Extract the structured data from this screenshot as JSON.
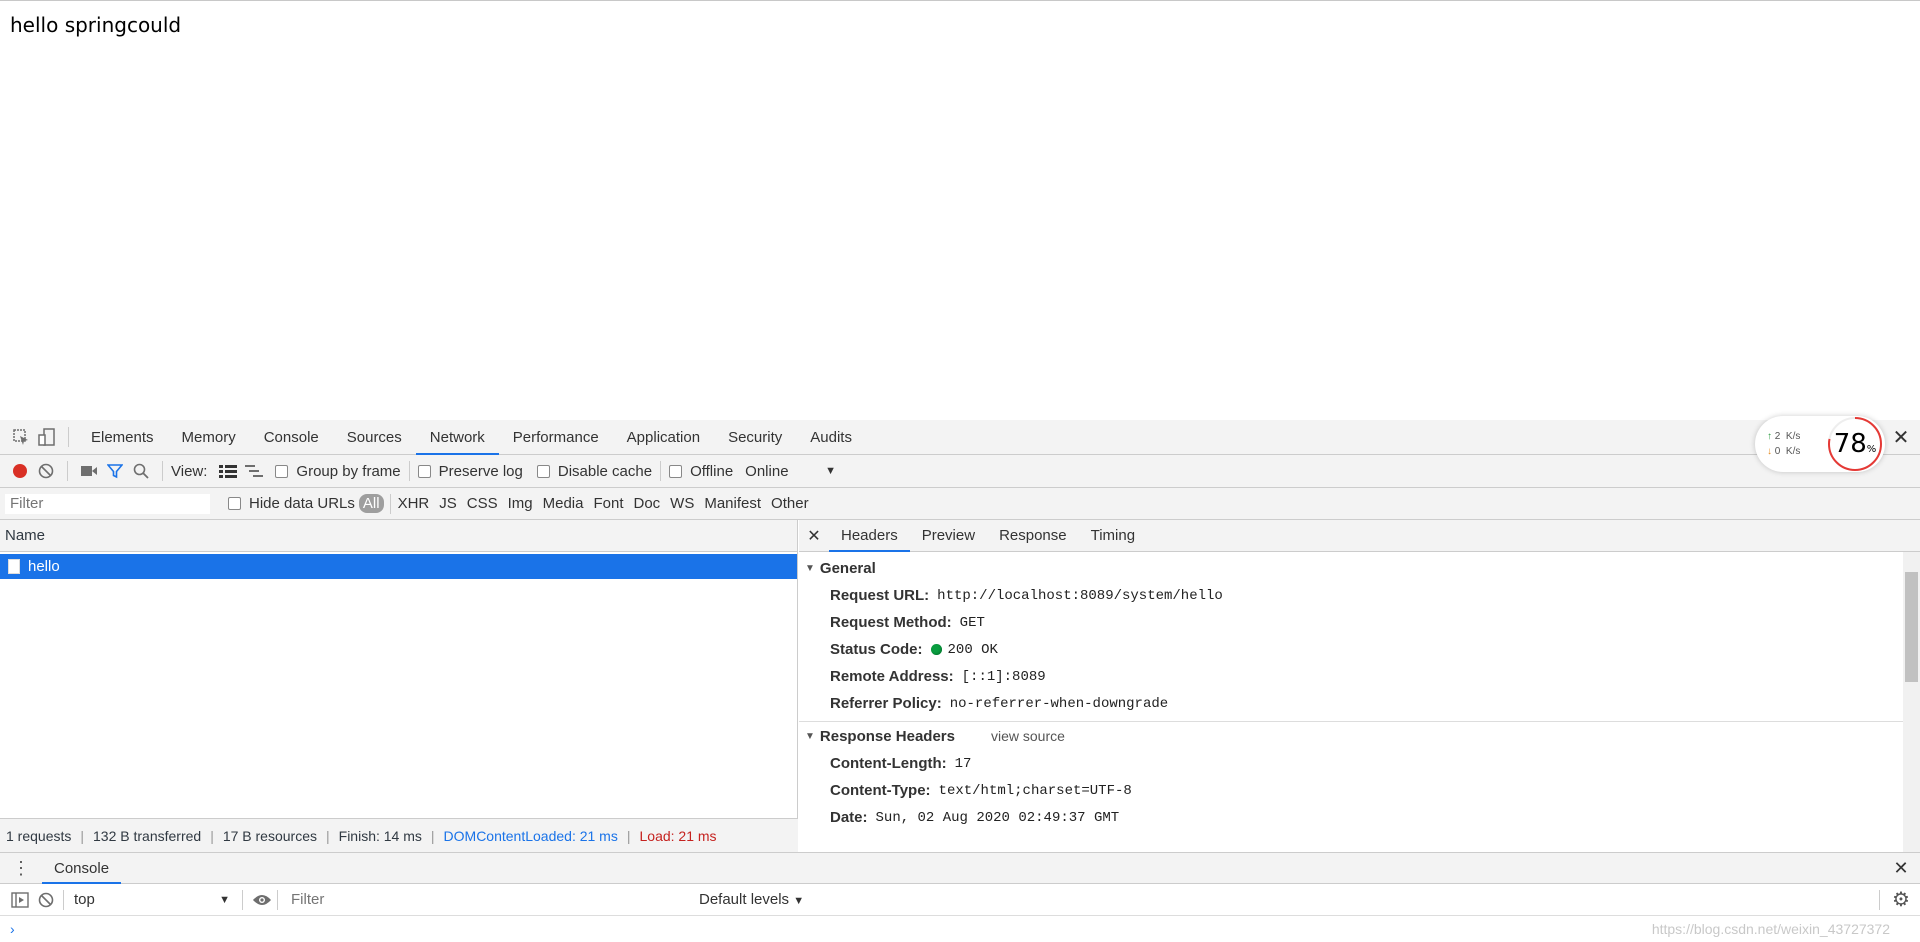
{
  "page": {
    "text": "hello springcould"
  },
  "devtools": {
    "tabs": [
      "Elements",
      "Memory",
      "Console",
      "Sources",
      "Network",
      "Performance",
      "Application",
      "Security",
      "Audits"
    ],
    "active_tab": "Network",
    "toolbar": {
      "view_label": "View:",
      "group_by_frame": "Group by frame",
      "preserve_log": "Preserve log",
      "disable_cache": "Disable cache",
      "offline": "Offline",
      "throttle": "Online"
    },
    "filter": {
      "placeholder": "Filter",
      "hide_data_urls": "Hide data URLs",
      "types": [
        "All",
        "XHR",
        "JS",
        "CSS",
        "Img",
        "Media",
        "Font",
        "Doc",
        "WS",
        "Manifest",
        "Other"
      ]
    },
    "requests": {
      "column_name": "Name",
      "rows": [
        "hello"
      ]
    },
    "summary": {
      "requests": "1 requests",
      "transferred": "132 B transferred",
      "resources": "17 B resources",
      "finish": "Finish: 14 ms",
      "dom_content_loaded": "DOMContentLoaded: 21 ms",
      "load": "Load: 21 ms"
    },
    "detail": {
      "tabs": [
        "Headers",
        "Preview",
        "Response",
        "Timing"
      ],
      "active_tab": "Headers",
      "general_title": "General",
      "general": [
        {
          "key": "Request URL:",
          "value": "http://localhost:8089/system/hello"
        },
        {
          "key": "Request Method:",
          "value": "GET"
        },
        {
          "key": "Status Code:",
          "value": "200 OK"
        },
        {
          "key": "Remote Address:",
          "value": "[::1]:8089"
        },
        {
          "key": "Referrer Policy:",
          "value": "no-referrer-when-downgrade"
        }
      ],
      "response_headers_title": "Response Headers",
      "view_source": "view source",
      "response_headers": [
        {
          "key": "Content-Length:",
          "value": "17"
        },
        {
          "key": "Content-Type:",
          "value": "text/html;charset=UTF-8"
        },
        {
          "key": "Date:",
          "value": "Sun, 02 Aug 2020 02:49:37 GMT"
        }
      ]
    },
    "drawer": {
      "tab": "Console",
      "context": "top",
      "filter_placeholder": "Filter",
      "levels": "Default levels"
    }
  },
  "net_widget": {
    "up": "2",
    "down": "0",
    "unit": "K/s",
    "percent": "78",
    "percent_sign": "%"
  },
  "watermark": "https://blog.csdn.net/weixin_43727372",
  "colors": {
    "accent": "#1a73e8",
    "record": "#d93025",
    "status_ok": "#0a9e40",
    "load": "#c5221f"
  }
}
